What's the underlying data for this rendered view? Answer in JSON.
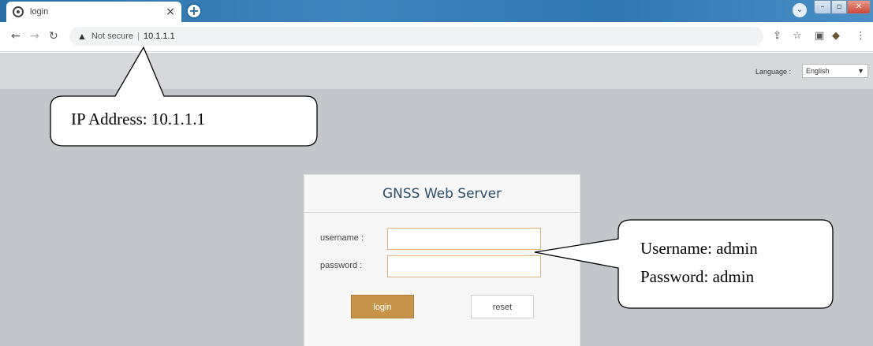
{
  "browser": {
    "tab_title": "login",
    "tab_close": "×",
    "new_tab": "+",
    "security_label": "Not secure",
    "url_separator": "|",
    "url": "10.1.1.1"
  },
  "page": {
    "language_label": "Language :",
    "language_value": "English"
  },
  "login": {
    "title": "GNSS Web Server",
    "username_label": "username :",
    "password_label": "password :",
    "username_value": "",
    "password_value": "",
    "login_button": "login",
    "reset_button": "reset"
  },
  "annotations": {
    "ip_callout": "IP Address: 10.1.1.1",
    "username_callout": "Username: admin",
    "password_callout": "Password: admin"
  },
  "colors": {
    "login_button_bg": "#c8944a",
    "input_border": "#e0b47a",
    "title_color": "#2d4e6b",
    "page_bg": "#c3c6ca",
    "tabstrip": "#2a6fa5"
  },
  "icons": [
    "favicon-icon",
    "close-icon",
    "plus-icon",
    "back-arrow-icon",
    "forward-arrow-icon",
    "reload-icon",
    "warning-icon",
    "share-icon",
    "star-icon",
    "sidebar-icon",
    "extension-icon",
    "more-icon",
    "chevron-down-icon"
  ]
}
